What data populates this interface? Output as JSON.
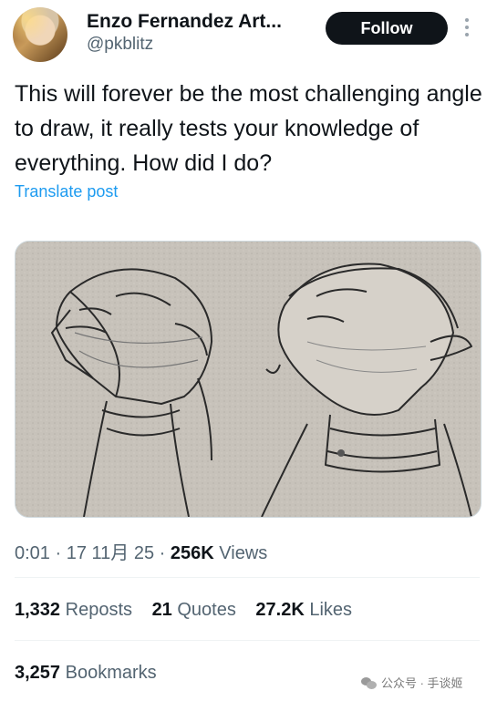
{
  "user": {
    "name": "Enzo Fernandez Art...",
    "handle": "@pkblitz",
    "follow_label": "Follow"
  },
  "tweet": {
    "text": "This will forever be the most challenging angle to draw, it really tests your knowledge of everything. How did I do?",
    "translate_label": "Translate post"
  },
  "meta": {
    "time": "0:01",
    "date": "17 11月 25",
    "views_count": "256K",
    "views_label": "Views",
    "sep": "·"
  },
  "stats": {
    "reposts_count": "1,332",
    "reposts_label": "Reposts",
    "quotes_count": "21",
    "quotes_label": "Quotes",
    "likes_count": "27.2K",
    "likes_label": "Likes",
    "bookmarks_count": "3,257",
    "bookmarks_label": "Bookmarks"
  },
  "watermark": {
    "text": "公众号 · 手谈姬",
    "icon": "wechat-icon"
  },
  "colors": {
    "accent": "#1d9bf0",
    "button_bg": "#0f1419",
    "secondary_text": "#536471"
  },
  "icons": {
    "more": "more-vertical-icon"
  }
}
